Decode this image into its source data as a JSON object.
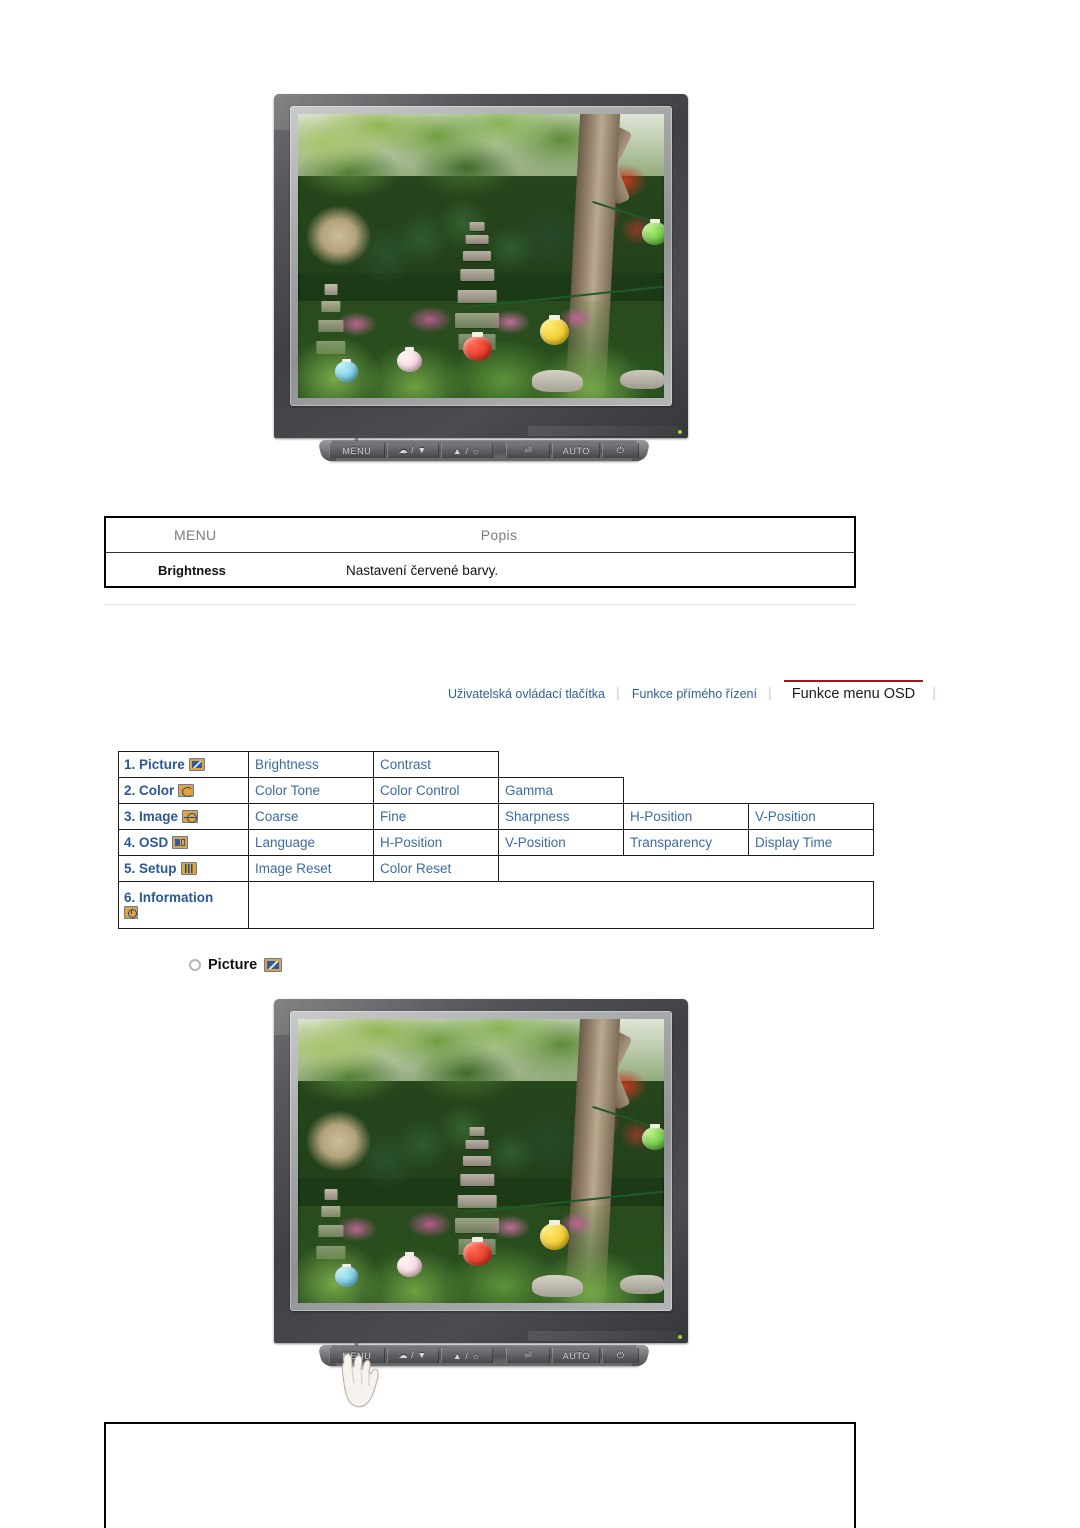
{
  "monitor_top": {
    "alt": "Samsung LCD monitor displaying a garden photo with a stone pagoda and paper lanterns",
    "buttons": [
      {
        "name": "menu-button",
        "label": "MENU"
      },
      {
        "name": "brightness-down-button",
        "label": "☁ / ▼"
      },
      {
        "name": "brightness-up-button",
        "label": "▲ / ☼"
      },
      {
        "name": "enter-button",
        "label": "⏎"
      },
      {
        "name": "auto-button",
        "label": "AUTO"
      },
      {
        "name": "power-button",
        "label": "⏻"
      }
    ]
  },
  "description_table": {
    "header": {
      "menu": "MENU",
      "popis": "Popis"
    },
    "rows": [
      {
        "menu": "Brightness",
        "popis": "Nastavení červené barvy."
      }
    ]
  },
  "navbar": {
    "items": [
      {
        "label": "Uživatelská ovládací tlačítka",
        "active": false
      },
      {
        "label": "Funkce přímého řízení",
        "active": false
      },
      {
        "label": "Funkce menu OSD",
        "active": true
      }
    ],
    "separator": "│",
    "active_color": "#9e1a1a",
    "link_color": "#2e6094"
  },
  "osd_table": {
    "rows": [
      {
        "label": "1. Picture",
        "icon": "picture-icon",
        "items": [
          "Brightness",
          "Contrast"
        ]
      },
      {
        "label": "2. Color",
        "icon": "color-icon",
        "items": [
          "Color Tone",
          "Color Control",
          "Gamma"
        ]
      },
      {
        "label": "3. Image",
        "icon": "image-icon",
        "items": [
          "Coarse",
          "Fine",
          "Sharpness",
          "H-Position",
          "V-Position"
        ]
      },
      {
        "label": "4. OSD",
        "icon": "osd-icon",
        "items": [
          "Language",
          "H-Position",
          "V-Position",
          "Transparency",
          "Display Time"
        ]
      },
      {
        "label": "5. Setup",
        "icon": "setup-icon",
        "items": [
          "Image Reset",
          "Color Reset"
        ]
      },
      {
        "label": "6. Information",
        "icon": "information-icon",
        "items": []
      }
    ],
    "text_color": "#3b6ba5",
    "icon_color": "#e8a233"
  },
  "picture_section": {
    "heading": "Picture",
    "icon": "picture-icon"
  },
  "monitor_bottom": {
    "alt": "Samsung LCD monitor with a hand pressing the MENU button",
    "buttons": [
      {
        "name": "menu-button",
        "label": "MENU"
      },
      {
        "name": "brightness-down-button",
        "label": "☁ / ▼"
      },
      {
        "name": "brightness-up-button",
        "label": "▲ / ☼"
      },
      {
        "name": "enter-button",
        "label": "⏎"
      },
      {
        "name": "auto-button",
        "label": "AUTO"
      },
      {
        "name": "power-button",
        "label": "⏻"
      }
    ],
    "cursor": "hand-pointer-icon"
  }
}
